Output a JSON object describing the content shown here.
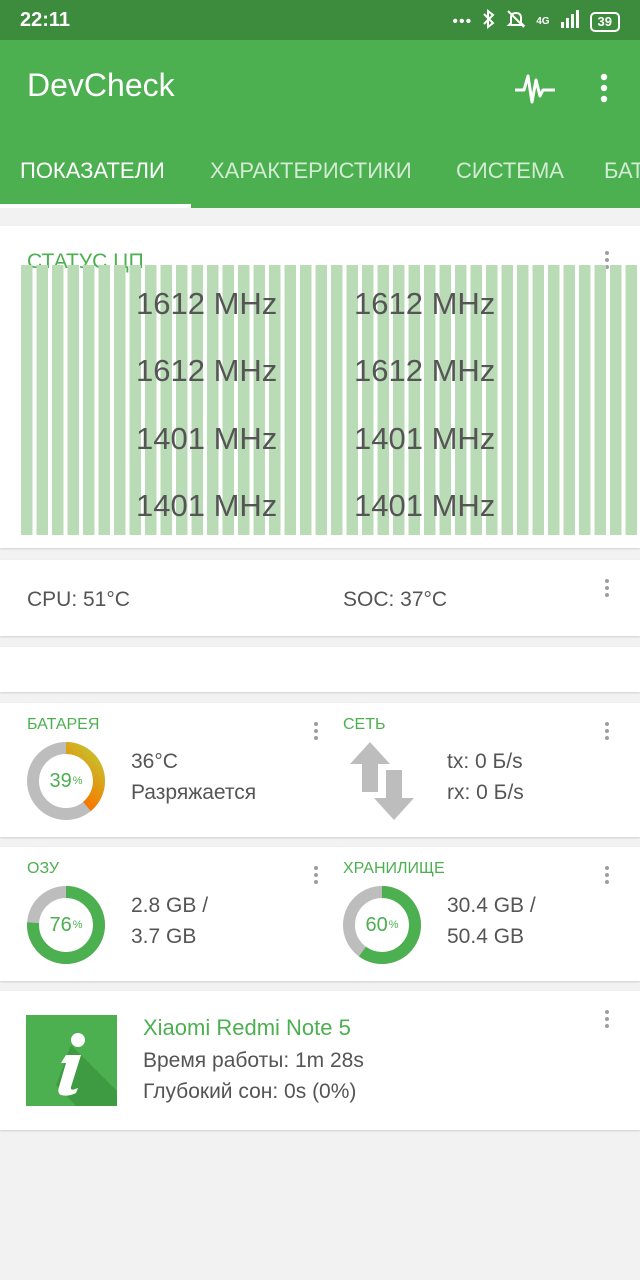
{
  "status_bar": {
    "time": "22:11",
    "network": "4G",
    "battery": "39"
  },
  "app": {
    "title": "DevCheck"
  },
  "tabs": [
    "ПОКАЗАТЕЛИ",
    "ХАРАКТЕРИСТИКИ",
    "СИСТЕМА",
    "БАТАРЕЯ"
  ],
  "cpu_status": {
    "title": "СТАТУС ЦП",
    "frequencies": [
      "1612 MHz",
      "1612 MHz",
      "1612 MHz",
      "1612 MHz",
      "1401 MHz",
      "1401 MHz",
      "1401 MHz",
      "1401 MHz"
    ]
  },
  "temps": {
    "cpu": "CPU: 51°C",
    "soc": "SOC: 37°C"
  },
  "battery": {
    "title": "БАТАРЕЯ",
    "percent": 39,
    "percent_label": "39",
    "unit": "%",
    "temp": "36°C",
    "state": "Разряжается"
  },
  "network": {
    "title": "СЕТЬ",
    "tx": "tx: 0 Б/s",
    "rx": "rx: 0 Б/s"
  },
  "ram": {
    "title": "ОЗУ",
    "percent": 76,
    "percent_label": "76",
    "unit": "%",
    "used": "2.8 GB /",
    "total": "3.7 GB"
  },
  "storage": {
    "title": "ХРАНИЛИЩЕ",
    "percent": 60,
    "percent_label": "60",
    "unit": "%",
    "used": "30.4 GB /",
    "total": "50.4 GB"
  },
  "device": {
    "name": "Xiaomi Redmi Note 5",
    "uptime": "Время работы: 1m 28s",
    "deep_sleep": "Глубокий сон: 0s (0%)"
  },
  "colors": {
    "primary": "#4caf50",
    "primary_dark": "#3d8b3d",
    "bar_fill": "#b9dbb5",
    "donut_track": "#bdbdbd"
  }
}
